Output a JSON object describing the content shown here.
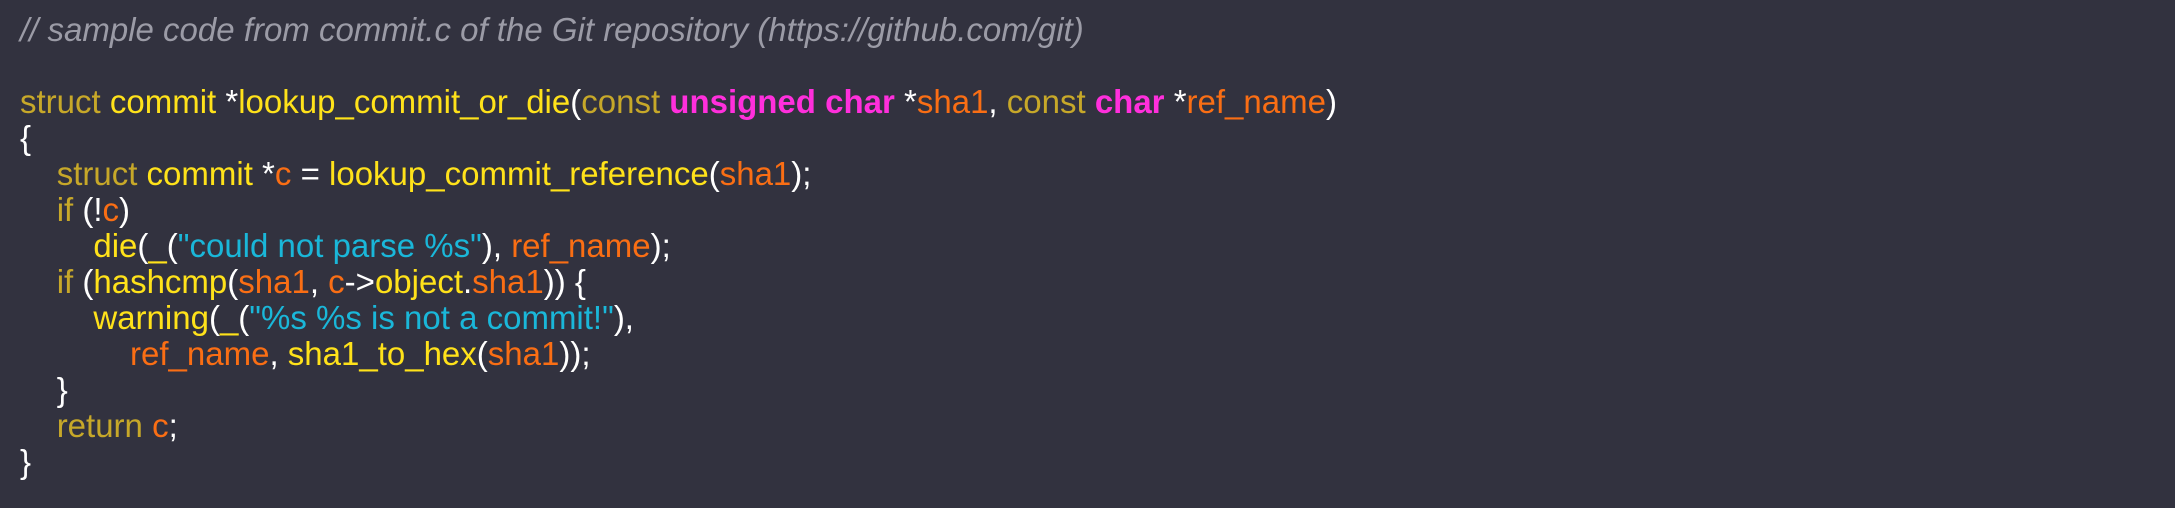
{
  "code": {
    "lines": [
      [
        {
          "text": "// sample code from commit.c of the Git repository (https://github.com/git)",
          "color": "#9b9ba6",
          "italic": true
        }
      ],
      [],
      [
        {
          "text": "struct",
          "color": "#c7a829"
        },
        {
          "text": " ",
          "color": "#ffffff"
        },
        {
          "text": "commit",
          "color": "#ffe21a"
        },
        {
          "text": " *",
          "color": "#ffffff"
        },
        {
          "text": "lookup_commit_or_die",
          "color": "#ffe21a"
        },
        {
          "text": "(",
          "color": "#ffffff"
        },
        {
          "text": "const",
          "color": "#c7a829"
        },
        {
          "text": " ",
          "color": "#ffffff"
        },
        {
          "text": "unsigned",
          "color": "#ff2fdc",
          "bold": true
        },
        {
          "text": " ",
          "color": "#ffffff"
        },
        {
          "text": "char",
          "color": "#ff2fdc",
          "bold": true
        },
        {
          "text": " *",
          "color": "#ffffff"
        },
        {
          "text": "sha1",
          "color": "#fa6e14"
        },
        {
          "text": ", ",
          "color": "#ffffff"
        },
        {
          "text": "const",
          "color": "#c7a829"
        },
        {
          "text": " ",
          "color": "#ffffff"
        },
        {
          "text": "char",
          "color": "#ff2fdc",
          "bold": true
        },
        {
          "text": " *",
          "color": "#ffffff"
        },
        {
          "text": "ref_name",
          "color": "#fa6e14"
        },
        {
          "text": ")",
          "color": "#ffffff"
        }
      ],
      [
        {
          "text": "{",
          "color": "#ffffff"
        }
      ],
      [
        {
          "text": "    ",
          "color": "#ffffff"
        },
        {
          "text": "struct",
          "color": "#c7a829"
        },
        {
          "text": " ",
          "color": "#ffffff"
        },
        {
          "text": "commit",
          "color": "#ffe21a"
        },
        {
          "text": " *",
          "color": "#ffffff"
        },
        {
          "text": "c",
          "color": "#fa6e14"
        },
        {
          "text": " = ",
          "color": "#ffffff"
        },
        {
          "text": "lookup_commit_reference",
          "color": "#ffe21a"
        },
        {
          "text": "(",
          "color": "#ffffff"
        },
        {
          "text": "sha1",
          "color": "#fa6e14"
        },
        {
          "text": ");",
          "color": "#ffffff"
        }
      ],
      [
        {
          "text": "    ",
          "color": "#ffffff"
        },
        {
          "text": "if",
          "color": "#c7a829"
        },
        {
          "text": " (!",
          "color": "#ffffff"
        },
        {
          "text": "c",
          "color": "#fa6e14"
        },
        {
          "text": ")",
          "color": "#ffffff"
        }
      ],
      [
        {
          "text": "        ",
          "color": "#ffffff"
        },
        {
          "text": "die",
          "color": "#ffe21a"
        },
        {
          "text": "(",
          "color": "#ffffff"
        },
        {
          "text": "_",
          "color": "#ffe21a"
        },
        {
          "text": "(",
          "color": "#ffffff"
        },
        {
          "text": "\"could not parse %s\"",
          "color": "#1ab7d9"
        },
        {
          "text": "), ",
          "color": "#ffffff"
        },
        {
          "text": "ref_name",
          "color": "#fa6e14"
        },
        {
          "text": ");",
          "color": "#ffffff"
        }
      ],
      [
        {
          "text": "    ",
          "color": "#ffffff"
        },
        {
          "text": "if",
          "color": "#c7a829"
        },
        {
          "text": " (",
          "color": "#ffffff"
        },
        {
          "text": "hashcmp",
          "color": "#ffe21a"
        },
        {
          "text": "(",
          "color": "#ffffff"
        },
        {
          "text": "sha1",
          "color": "#fa6e14"
        },
        {
          "text": ", ",
          "color": "#ffffff"
        },
        {
          "text": "c",
          "color": "#fa6e14"
        },
        {
          "text": "->",
          "color": "#ffffff"
        },
        {
          "text": "object",
          "color": "#ffe21a"
        },
        {
          "text": ".",
          "color": "#ffffff"
        },
        {
          "text": "sha1",
          "color": "#fa6e14"
        },
        {
          "text": ")) {",
          "color": "#ffffff"
        }
      ],
      [
        {
          "text": "        ",
          "color": "#ffffff"
        },
        {
          "text": "warning",
          "color": "#ffe21a"
        },
        {
          "text": "(",
          "color": "#ffffff"
        },
        {
          "text": "_",
          "color": "#ffe21a"
        },
        {
          "text": "(",
          "color": "#ffffff"
        },
        {
          "text": "\"%s %s is not a commit!\"",
          "color": "#1ab7d9"
        },
        {
          "text": "),",
          "color": "#ffffff"
        }
      ],
      [
        {
          "text": "            ",
          "color": "#ffffff"
        },
        {
          "text": "ref_name",
          "color": "#fa6e14"
        },
        {
          "text": ", ",
          "color": "#ffffff"
        },
        {
          "text": "sha1_to_hex",
          "color": "#ffe21a"
        },
        {
          "text": "(",
          "color": "#ffffff"
        },
        {
          "text": "sha1",
          "color": "#fa6e14"
        },
        {
          "text": "));",
          "color": "#ffffff"
        }
      ],
      [
        {
          "text": "    ",
          "color": "#ffffff"
        },
        {
          "text": "}",
          "color": "#ffffff"
        }
      ],
      [
        {
          "text": "    ",
          "color": "#ffffff"
        },
        {
          "text": "return",
          "color": "#c7a829"
        },
        {
          "text": " ",
          "color": "#ffffff"
        },
        {
          "text": "c",
          "color": "#fa6e14"
        },
        {
          "text": ";",
          "color": "#ffffff"
        }
      ],
      [
        {
          "text": "}",
          "color": "#ffffff"
        }
      ]
    ]
  },
  "colors": {
    "background": "#32323f",
    "comment": "#9b9ba6",
    "keyword": "#c7a829",
    "type": "#ff2fdc",
    "identifier": "#ffe21a",
    "variable": "#fa6e14",
    "string": "#1ab7d9",
    "punctuation": "#ffffff"
  }
}
